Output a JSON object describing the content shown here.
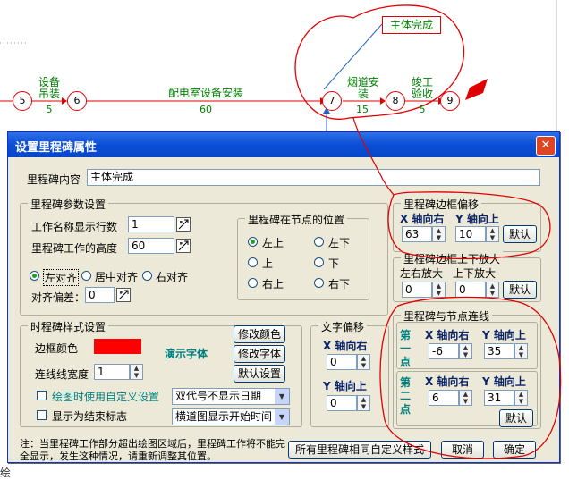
{
  "diagram": {
    "milestone_tag": "主体完成",
    "nodes": [
      "5",
      "6",
      "7",
      "8",
      "9"
    ],
    "tasks": [
      {
        "label1": "设备",
        "label2": "吊装",
        "duration": "5"
      },
      {
        "label1": "配电室设备安装",
        "label2": "",
        "duration": "60"
      },
      {
        "label1": "烟道安",
        "label2": "装",
        "duration": "15"
      },
      {
        "label1": "竣工",
        "label2": "验收",
        "duration": "5"
      }
    ],
    "line_color": "#e00000"
  },
  "dialog": {
    "title": "设置里程碑属性",
    "content_label": "里程碑内容",
    "content_value": "主体完成",
    "params": {
      "title": "里程碑参数设置",
      "rows_label": "工作名称显示行数",
      "rows_value": "1",
      "height_label": "里程碑工作的高度",
      "height_value": "60",
      "align_left": "左对齐",
      "align_center": "居中对齐",
      "align_right": "右对齐",
      "offset_label": "对齐偏差：",
      "offset_value": "0",
      "position": {
        "title": "里程碑在节点的位置",
        "options": [
          "左上",
          "左下",
          "上",
          "下",
          "右上",
          "右下"
        ],
        "selected": "左上"
      }
    },
    "border_offset": {
      "title": "里程碑边框偏移",
      "x_label": "X 轴向右",
      "y_label": "Y 轴向上",
      "x_value": "63",
      "y_value": "10",
      "default_btn": "默认"
    },
    "border_scale": {
      "title": "里程碑边框上下放大",
      "lr_label": "左右放大",
      "ud_label": "上下放大",
      "lr_value": "0",
      "ud_value": "0",
      "default_btn": "默认"
    },
    "style": {
      "title": "时程碑样式设置",
      "border_color_label": "边框颜色",
      "border_color": "#ff0000",
      "demo_font": "演示字体",
      "line_width_label": "连线线宽度",
      "line_width_value": "1",
      "btn_color": "修改颜色",
      "btn_font": "修改字体",
      "btn_default": "默认设置",
      "chk_custom": "绘图时使用自定义设置",
      "chk_end": "显示为结束标志",
      "select_date": "双代号不显示日期",
      "select_time": "横道图显示开始时间"
    },
    "text_offset": {
      "title": "文字偏移",
      "x_label": "X 轴向右",
      "x_value": "0",
      "y_label": "Y 轴向上",
      "y_value": "0"
    },
    "connect": {
      "title": "里程碑与节点连线",
      "p1_label": "第一点",
      "p2_label": "第二点",
      "x_label": "X 轴向右",
      "y_label": "Y 轴向上",
      "p1_x": "-6",
      "p1_y": "35",
      "p2_x": "6",
      "p2_y": "31",
      "default_btn": "默认"
    },
    "note": "注：当里程碑工作部分超出绘图区域后，里程碑工作将不能完全显示，发生这种情况，请重新调整其位置。",
    "btn_all": "所有里程碑相同自定义样式",
    "btn_cancel": "取消",
    "btn_ok": "确定"
  },
  "status_char": "绘"
}
